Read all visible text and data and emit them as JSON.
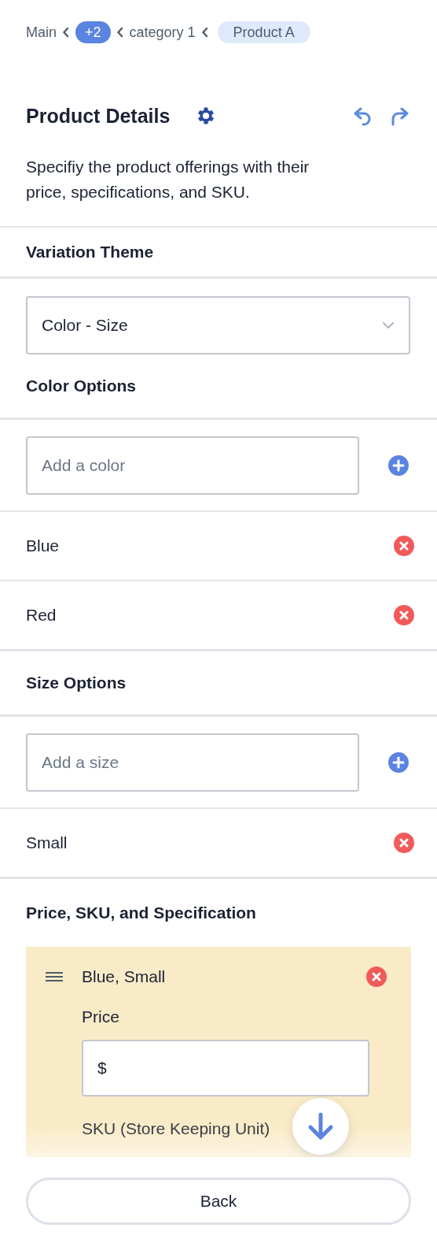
{
  "breadcrumb": [
    {
      "kind": "link",
      "label": "Main"
    },
    {
      "kind": "collapsed",
      "label": "+2"
    },
    {
      "kind": "link",
      "label": "category 1"
    },
    {
      "kind": "current",
      "label": "Product A"
    }
  ],
  "header": {
    "title": "Product Details",
    "description": "Specifiy the product offerings with their price, specifications, and SKU."
  },
  "sections": [
    {
      "kind": "select",
      "heading": "Variation Theme",
      "value": "Color - Size"
    },
    {
      "kind": "options",
      "heading": "Color Options",
      "placeholder": "Add a color",
      "items": [
        "Blue",
        "Red"
      ]
    },
    {
      "kind": "options",
      "heading": "Size Options",
      "placeholder": "Add a size",
      "items": [
        "Small"
      ]
    },
    {
      "kind": "variants",
      "heading": "Price, SKU, and Specification",
      "variants": [
        {
          "name": "Blue, Small",
          "price_label": "Price",
          "price_value": "$",
          "sku_label": "SKU (Store Keeping Unit)"
        }
      ]
    }
  ],
  "footer": {
    "back_button": "Back"
  }
}
